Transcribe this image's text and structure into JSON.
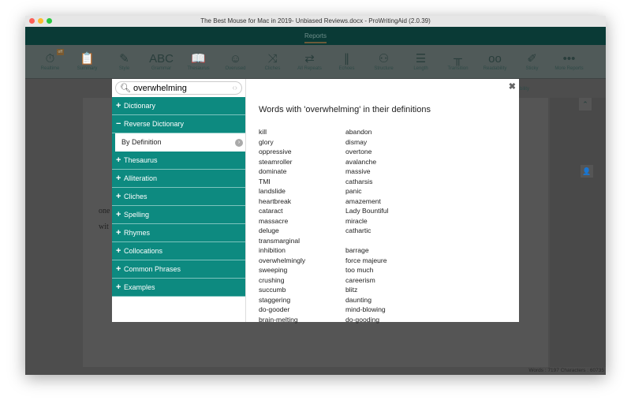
{
  "window": {
    "title": "The Best Mouse for Mac in 2019- Unbiased Reviews.docx - ProWritingAid (2.0.39)"
  },
  "header": {
    "tab": "Reports"
  },
  "toolbar": {
    "badge": "off",
    "items": [
      {
        "label": "Realtime",
        "icon": "stopwatch-icon",
        "glyph": "⏱"
      },
      {
        "label": "Summary",
        "icon": "clipboard-icon",
        "glyph": "📋"
      },
      {
        "label": "Style",
        "icon": "pen-icon",
        "glyph": "✎"
      },
      {
        "label": "Grammar",
        "icon": "abc-icon",
        "glyph": "ABC"
      },
      {
        "label": "Thesaurus",
        "icon": "book-icon",
        "glyph": "📖"
      },
      {
        "label": "Overused",
        "icon": "face-icon",
        "glyph": "☺"
      },
      {
        "label": "Cliches",
        "icon": "shuffle-icon",
        "glyph": "⤨"
      },
      {
        "label": "All Repeats",
        "icon": "repeat-icon",
        "glyph": "⇄"
      },
      {
        "label": "Echoes",
        "icon": "soundwave-icon",
        "glyph": "∥"
      },
      {
        "label": "Structure",
        "icon": "structure-icon",
        "glyph": "⚇"
      },
      {
        "label": "Length",
        "icon": "length-icon",
        "glyph": "☰"
      },
      {
        "label": "Transition",
        "icon": "bridge-icon",
        "glyph": "╥"
      },
      {
        "label": "Readability",
        "icon": "glasses-icon",
        "glyph": "oo"
      },
      {
        "label": "Sticky",
        "icon": "sticky-icon",
        "glyph": "✐"
      },
      {
        "label": "More Reports",
        "icon": "more-icon",
        "glyph": "•••"
      }
    ]
  },
  "document": {
    "fragments": [
      "nd",
      "one",
      "ct",
      "wit"
    ],
    "partial_label": "bility"
  },
  "status": "Words : 7197 Characters : 60735",
  "dialog": {
    "search_value": "overwhelming",
    "menu": [
      {
        "label": "Dictionary",
        "state": "+"
      },
      {
        "label": "Reverse Dictionary",
        "state": "−",
        "sub": "By Definition"
      },
      {
        "label": "Thesaurus",
        "state": "+"
      },
      {
        "label": "Alliteration",
        "state": "+"
      },
      {
        "label": "Cliches",
        "state": "+"
      },
      {
        "label": "Spelling",
        "state": "+"
      },
      {
        "label": "Rhymes",
        "state": "+"
      },
      {
        "label": "Collocations",
        "state": "+"
      },
      {
        "label": "Common Phrases",
        "state": "+"
      },
      {
        "label": "Examples",
        "state": "+"
      }
    ],
    "heading": "Words with 'overwhelming' in their definitions",
    "col1": [
      "kill",
      "glory",
      "oppressive",
      "steamroller",
      "dominate",
      "TMI",
      "landslide",
      "heartbreak",
      "cataract",
      "massacre",
      "deluge",
      "transmarginal inhibition",
      "overwhelmingly",
      "sweeping",
      "crushing",
      "succumb",
      "staggering",
      "do-gooder",
      "brain-melting"
    ],
    "col2": [
      "abandon",
      "dismay",
      "overtone",
      "avalanche",
      "massive",
      "catharsis",
      "panic",
      "amazement",
      "Lady Bountiful",
      "miracle",
      "cathartic",
      "",
      "barrage",
      "force majeure",
      "too much",
      "careerism",
      "blitz",
      "daunting",
      "mind-blowing",
      "do-gooding"
    ]
  },
  "colors": {
    "teal": "#0d8a80",
    "header": "#0a3a36"
  }
}
